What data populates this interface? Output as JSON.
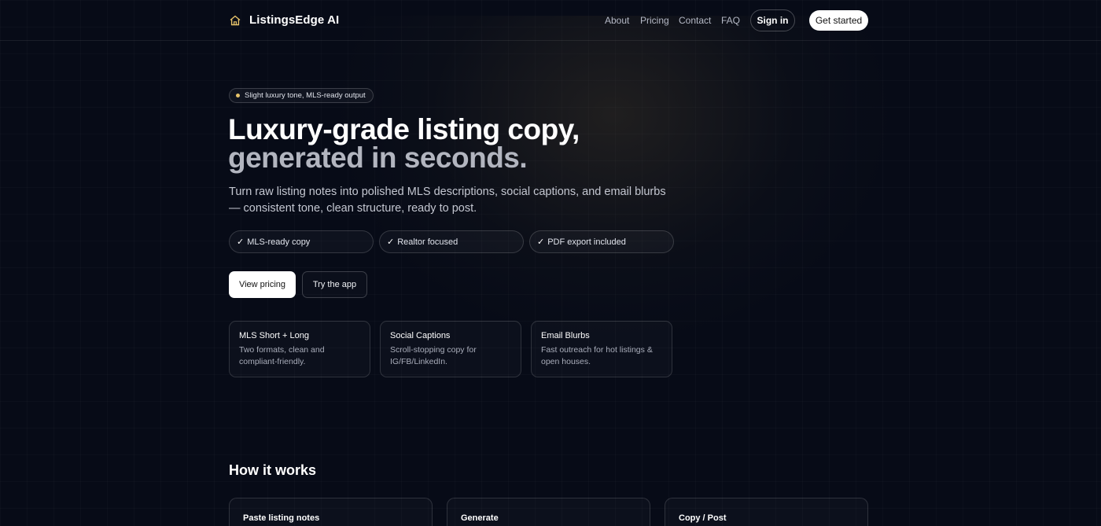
{
  "header": {
    "brand": "ListingsEdge AI",
    "nav": [
      {
        "label": "About"
      },
      {
        "label": "Pricing"
      },
      {
        "label": "Contact"
      },
      {
        "label": "FAQ"
      }
    ],
    "sign_in": "Sign in",
    "get_started": "Get started"
  },
  "hero": {
    "tag": "Slight luxury tone, MLS-ready output",
    "title_line1": "Luxury-grade listing copy,",
    "title_line2": "generated in seconds.",
    "subtitle": "Turn raw listing notes into polished MLS descriptions, social captions, and email blurbs — consistent tone, clean structure, ready to post.",
    "checks": [
      {
        "label": "MLS-ready copy"
      },
      {
        "label": "Realtor focused"
      },
      {
        "label": "PDF export included"
      }
    ],
    "check_mark": "✓",
    "primary_cta": "View pricing",
    "secondary_cta": "Try the app"
  },
  "features": [
    {
      "title": "MLS Short + Long",
      "desc": "Two formats, clean and compliant-friendly."
    },
    {
      "title": "Social Captions",
      "desc": "Scroll-stopping copy for IG/FB/LinkedIn."
    },
    {
      "title": "Email Blurbs",
      "desc": "Fast outreach for hot listings & open houses."
    }
  ],
  "how_it_works": {
    "title": "How it works",
    "steps": [
      {
        "title": "Paste listing notes"
      },
      {
        "title": "Generate"
      },
      {
        "title": "Copy / Post"
      }
    ]
  },
  "colors": {
    "background": "#070b17",
    "accent_dot": "#e8c46a",
    "primary_button": "#ffffff"
  },
  "icons": {
    "brand": "house-icon",
    "tag": "dot-icon",
    "check": "check-icon"
  }
}
